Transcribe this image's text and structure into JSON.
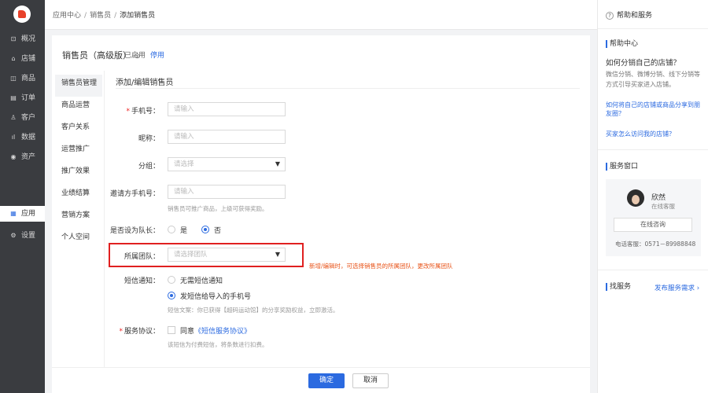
{
  "nav": {
    "items": [
      {
        "icon": "overview-icon",
        "glyph": "⊡",
        "label": "概况"
      },
      {
        "icon": "store-icon",
        "glyph": "⌂",
        "label": "店铺"
      },
      {
        "icon": "goods-icon",
        "glyph": "◫",
        "label": "商品"
      },
      {
        "icon": "order-icon",
        "glyph": "▤",
        "label": "订单"
      },
      {
        "icon": "customer-icon",
        "glyph": "♙",
        "label": "客户"
      },
      {
        "icon": "data-icon",
        "glyph": "ıl",
        "label": "数据"
      },
      {
        "icon": "asset-icon",
        "glyph": "◉",
        "label": "资产"
      }
    ],
    "app": {
      "label": "应用",
      "glyph": "▦"
    },
    "settings": {
      "label": "设置",
      "glyph": "⚙"
    }
  },
  "breadcrumb": {
    "level1": "应用中心",
    "level2": "销售员",
    "current": "添加销售员"
  },
  "header": {
    "title": "销售员（高级版）",
    "status": "已启用",
    "disable_link": "停用"
  },
  "subnav": [
    "销售员管理",
    "商品运营",
    "客户关系",
    "运营推广",
    "推广效果",
    "业绩结算",
    "营销方案",
    "个人空间"
  ],
  "form": {
    "title": "添加/编辑销售员",
    "phone": {
      "label": "手机号：",
      "placeholder": "请输入"
    },
    "nickname": {
      "label": "昵称：",
      "placeholder": "请输入"
    },
    "group": {
      "label": "分组：",
      "placeholder": "请选择"
    },
    "inviter": {
      "label": "邀请方手机号：",
      "placeholder": "请输入",
      "hint": "销售员可推广商品，上级可获得奖励。"
    },
    "leader": {
      "label": "是否设为队长：",
      "yes": "是",
      "no": "否"
    },
    "team": {
      "label": "所属团队：",
      "placeholder": "请选择团队",
      "warning": "新增/编辑时，可选择销售员的所属团队，更改所属团队"
    },
    "sms": {
      "label": "短信通知：",
      "option_none": "无需短信通知",
      "option_send": "发短信给导入的手机号",
      "hint": "短信文案：你已获得【超码运动馆】的分享奖励权益，立即激活。"
    },
    "agreement": {
      "label": "服务协议：",
      "prefix": "同意",
      "link": "《短信服务协议》",
      "hint": "该短信为付费短信，将条数进行扣费。"
    }
  },
  "footer": {
    "ok": "确定",
    "cancel": "取消"
  },
  "help": {
    "title": "帮助和服务",
    "center_title": "帮助中心",
    "question": "如何分销自己的店铺？",
    "answer": "微信分销、微博分销、线下分销等方式引导买家进入店铺。",
    "link1": "如何将自己的店铺或商品分享到朋友圈？",
    "link2": "买家怎么访问我的店铺？",
    "service_title": "服务窗口",
    "agent_name": "欣然",
    "agent_role": "在线客服",
    "consult_btn": "在线咨询",
    "tel": "电话客服：0571－89988848",
    "find_title": "找服务",
    "find_link": "发布服务需求 ›"
  },
  "colors": {
    "accent": "#2b6ae0",
    "nav_bg": "#3a3c40",
    "highlight_border": "#e02020",
    "warning": "#e8541a"
  }
}
